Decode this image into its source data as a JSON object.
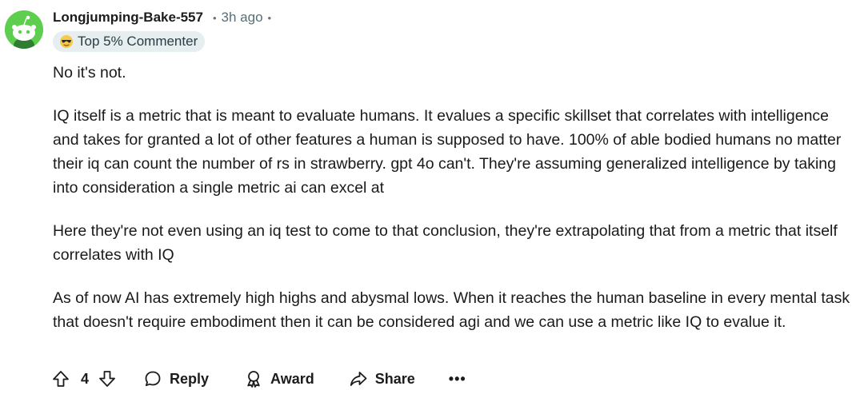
{
  "comment": {
    "username": "Longjumping-Bake-557",
    "separator": "•",
    "time": "3h ago",
    "separator2": "•",
    "flair": "Top 5% Commenter",
    "paragraphs": [
      "No it's not.",
      "IQ itself is a metric that is meant to evaluate humans. It evalues a specific skillset that correlates with intelligence and takes for granted a lot of other features a human is supposed to have. 100% of able bodied humans no matter their iq can count the number of rs in strawberry. gpt 4o can't. They're assuming generalized intelligence by taking into consideration a single metric ai can excel at",
      "Here they're not even using an iq test to come to that conclusion, they're extrapolating that from a metric that itself correlates with IQ",
      "As of now AI has extremely high highs and abysmal lows. When it reaches the human baseline in every mental task that doesn't require embodiment then it can be considered agi and we can use a metric like IQ to evalue it."
    ]
  },
  "actions": {
    "vote_count": "4",
    "reply_label": "Reply",
    "award_label": "Award",
    "share_label": "Share",
    "more_label": "•••"
  },
  "colors": {
    "avatar_bg": "#5ece4f",
    "flair_bg": "#e6eef0",
    "meta_text": "#576f76"
  },
  "icons": {
    "avatar": "reddit-snoo-avatar-icon",
    "flair": "sunglasses-emoji-icon",
    "upvote": "upvote-arrow-icon",
    "downvote": "downvote-arrow-icon",
    "reply": "speech-bubble-icon",
    "award": "award-ribbon-icon",
    "share": "share-arrow-icon"
  }
}
